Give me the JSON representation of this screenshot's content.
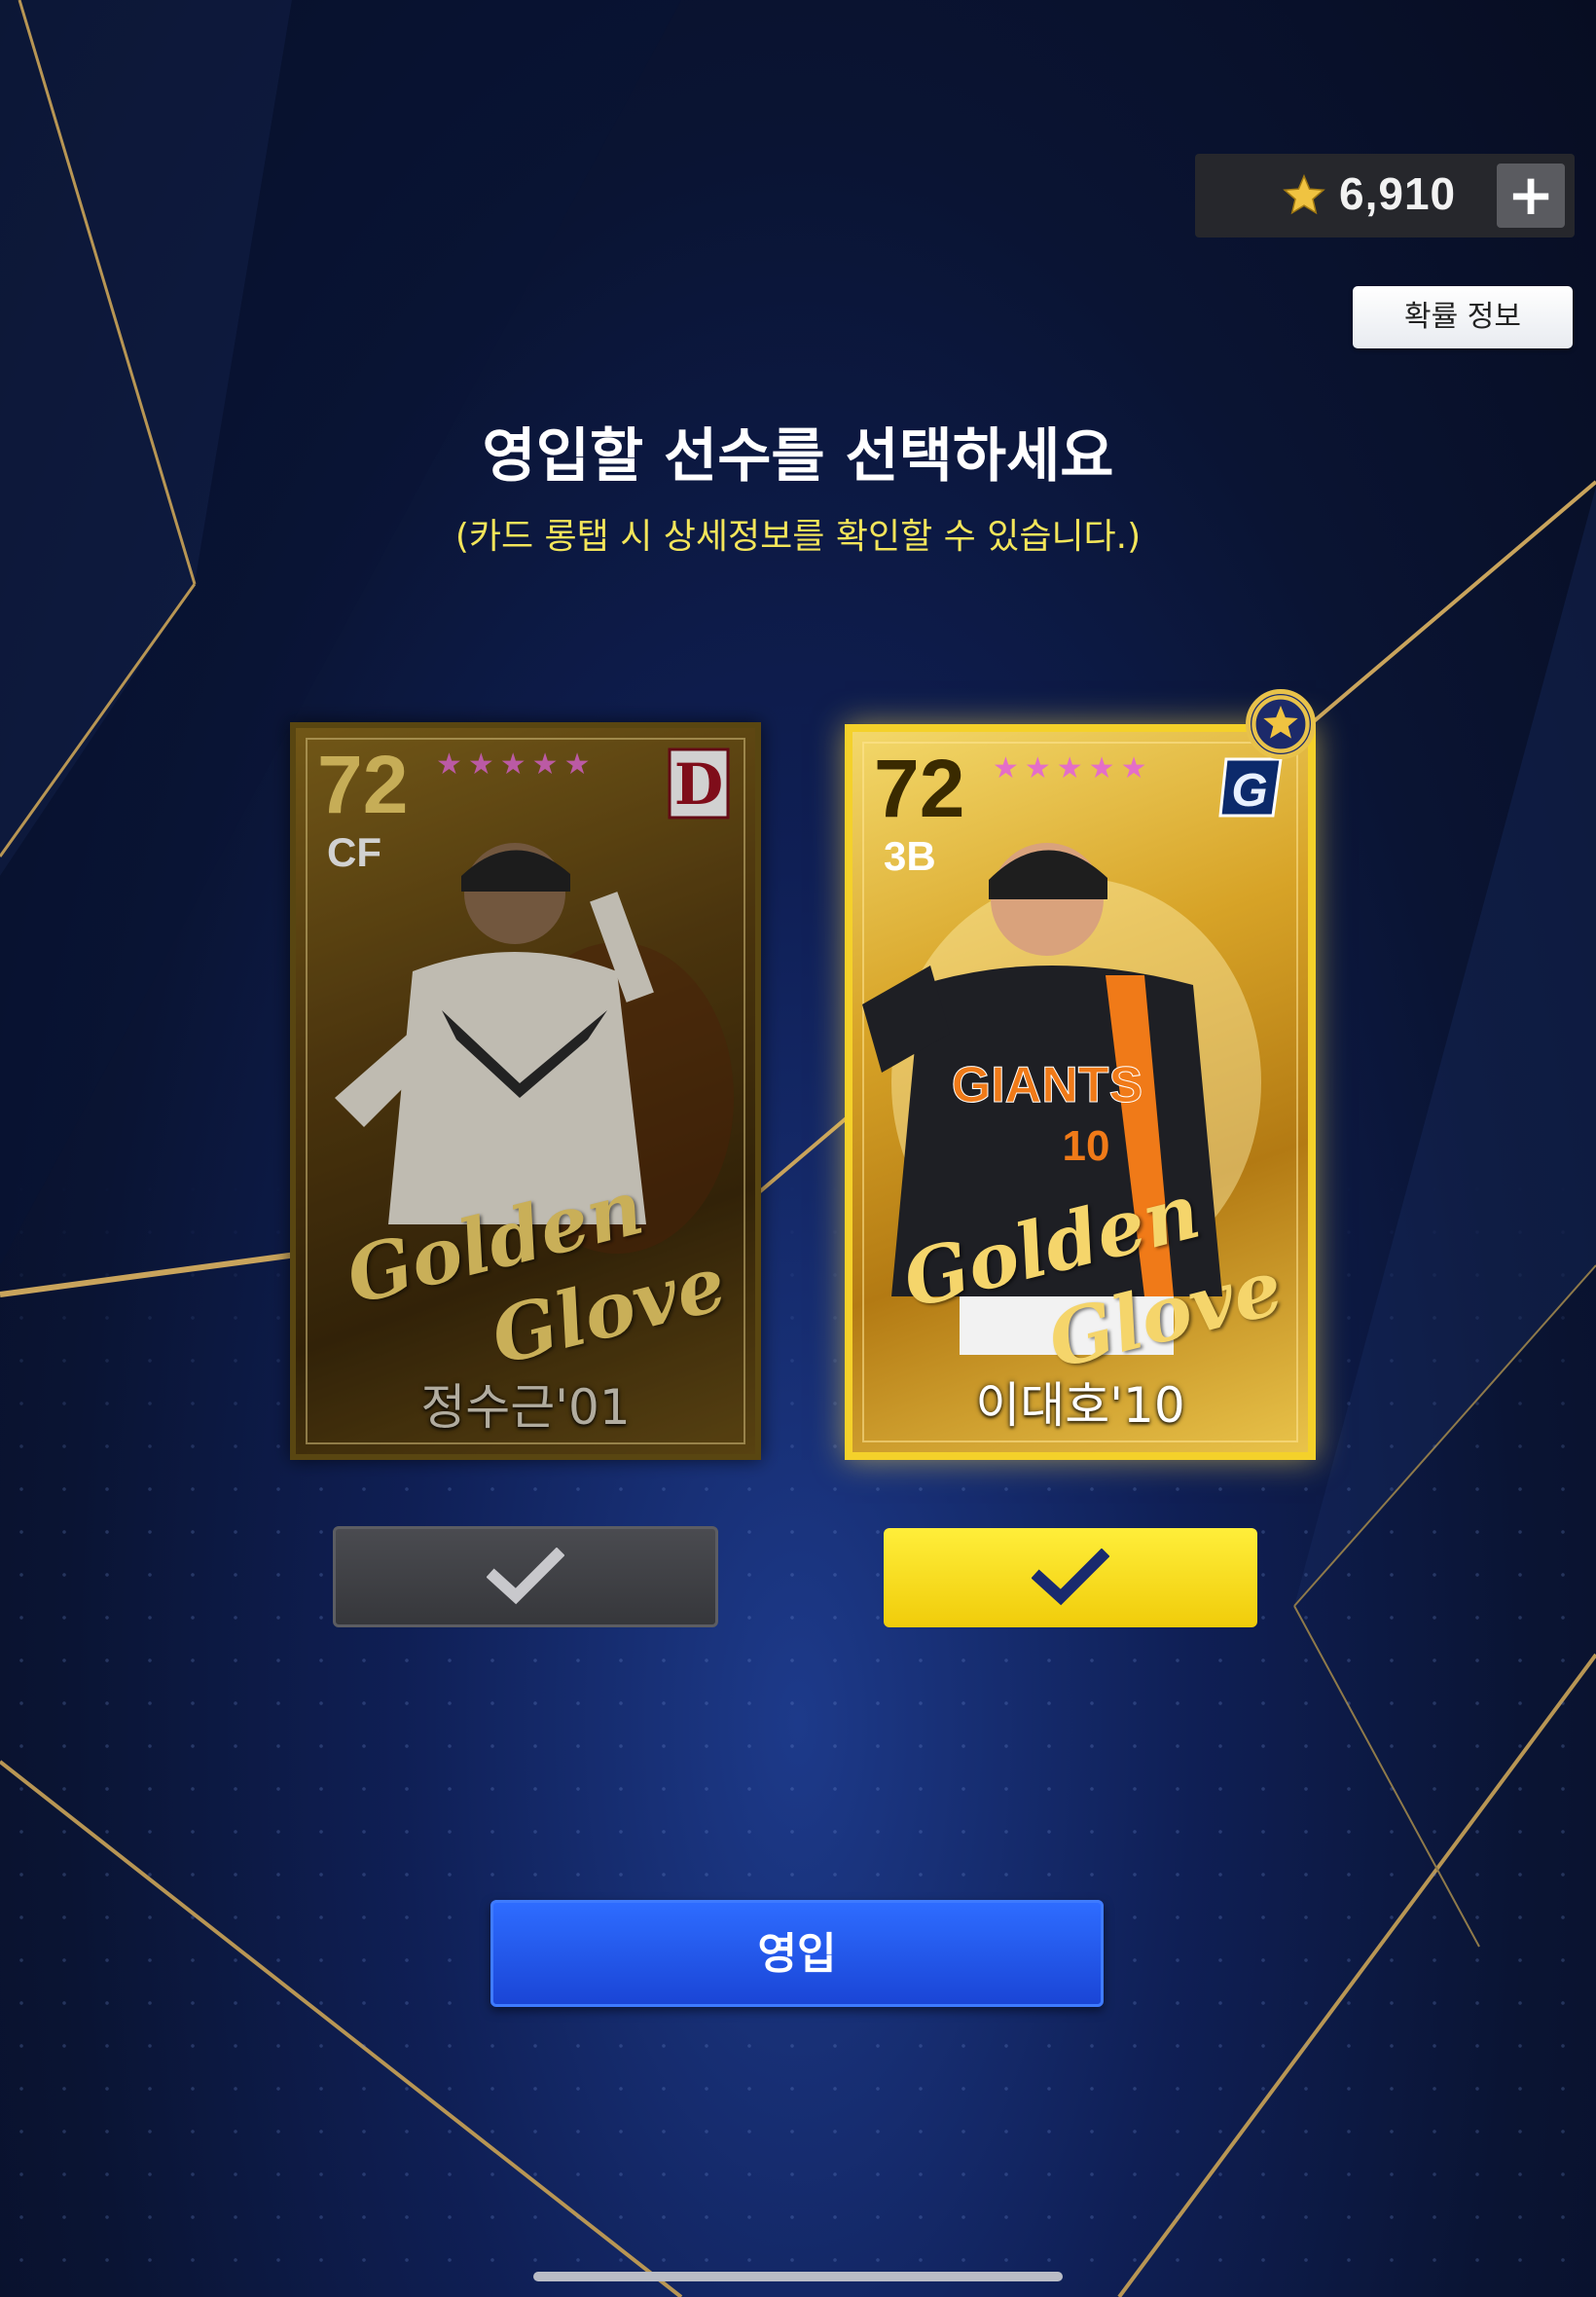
{
  "currency": {
    "icon": "star-icon",
    "amount": "6,910",
    "add_label": "+"
  },
  "probability_button": {
    "label": "확률 정보"
  },
  "heading": {
    "title": "영입할 선수를 선택하세요",
    "subtitle": "(카드 롱탭 시 상세정보를 확인할 수 있습니다.)"
  },
  "cards": [
    {
      "overall": "72",
      "position": "CF",
      "stars": "★★★★★",
      "team_logo": "D",
      "golden_word1": "Golden",
      "golden_word2": "Glove",
      "name": "정수근'01",
      "selected": false
    },
    {
      "overall": "72",
      "position": "3B",
      "stars": "★★★★★",
      "team_logo": "G",
      "golden_word1": "Golden",
      "golden_word2": "Glove",
      "name": "이대호'10",
      "selected": true
    }
  ],
  "recruit_button": {
    "label": "영입"
  },
  "colors": {
    "accent_yellow": "#f3e55a",
    "select_yellow": "#ffe81a",
    "recruit_blue": "#2455f0",
    "background": "#0a1433"
  }
}
